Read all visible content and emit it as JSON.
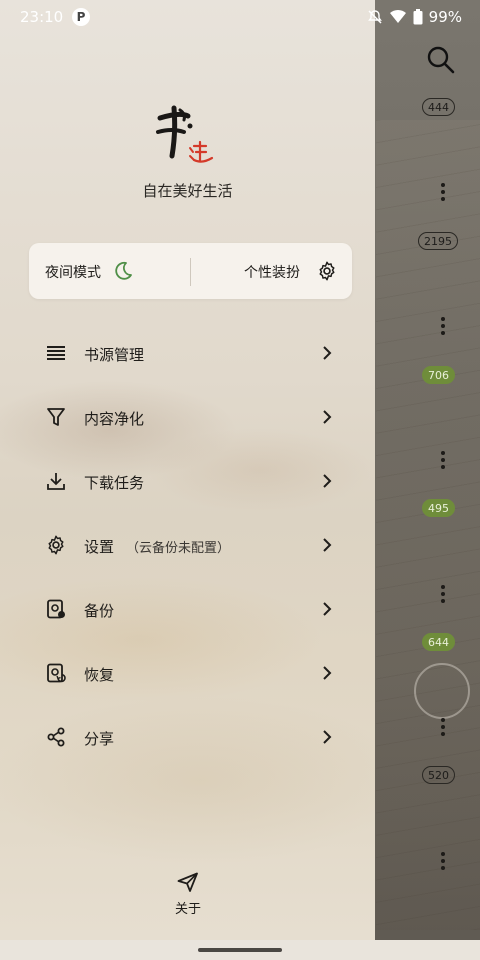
{
  "status_bar": {
    "time": "23:10",
    "app_icon_letter": "P",
    "battery": "99%"
  },
  "drawer": {
    "logo_text": "书迷",
    "slogan": "自在美好生活",
    "quick_card": {
      "night_mode_label": "夜间模式",
      "theme_label": "个性装扮"
    },
    "menu": [
      {
        "label": "书源管理",
        "sub": "",
        "icon": "list-icon"
      },
      {
        "label": "内容净化",
        "sub": "",
        "icon": "filter-icon"
      },
      {
        "label": "下载任务",
        "sub": "",
        "icon": "download-icon"
      },
      {
        "label": "设置",
        "sub": "（云备份未配置）",
        "icon": "gear-icon"
      },
      {
        "label": "备份",
        "sub": "",
        "icon": "backup-icon"
      },
      {
        "label": "恢复",
        "sub": "",
        "icon": "restore-icon"
      },
      {
        "label": "分享",
        "sub": "",
        "icon": "share-icon"
      }
    ],
    "about_label": "关于"
  },
  "background_list": {
    "badges": [
      "444",
      "2195",
      "706",
      "495",
      "644",
      "520"
    ]
  }
}
